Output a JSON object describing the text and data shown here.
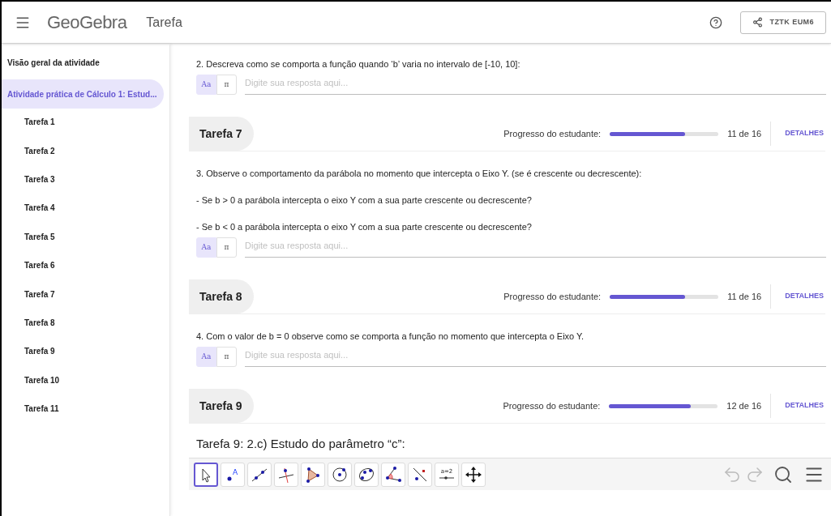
{
  "header": {
    "logo": "GeoGebra",
    "title": "Tarefa",
    "share_code": "TZTK EUM6"
  },
  "sidebar": {
    "overview": "Visão geral da atividade",
    "activity": {
      "label": "Atividade prática de Cálculo 1: Estud...",
      "selected": true
    },
    "items": [
      {
        "label": "Tarefa 1",
        "selected": false
      },
      {
        "label": "Tarefa 2",
        "selected": false
      },
      {
        "label": "Tarefa 3",
        "selected": false
      },
      {
        "label": "Tarefa 4",
        "selected": false
      },
      {
        "label": "Tarefa 5",
        "selected": false
      },
      {
        "label": "Tarefa 6",
        "selected": false
      },
      {
        "label": "Tarefa 7",
        "selected": false
      },
      {
        "label": "Tarefa 8",
        "selected": false
      },
      {
        "label": "Tarefa 9",
        "selected": false
      },
      {
        "label": "Tarefa 10",
        "selected": false
      },
      {
        "label": "Tarefa 11",
        "selected": false
      }
    ]
  },
  "blocks": [
    {
      "kind": "question",
      "lines": [
        "2. Descreva como se comporta a função quando ‘b’ varia no intervalo de [-10, 10]:"
      ],
      "modes": [
        {
          "label": "Aa",
          "selected": true
        },
        {
          "label": "π",
          "selected": false
        }
      ],
      "placeholder": "Digite sua resposta aqui..."
    },
    {
      "kind": "task",
      "title": "Tarefa 7",
      "progress_label": "Progresso do estudante:",
      "level": 0.69,
      "count": "11 de 16",
      "details": "DETALHES"
    },
    {
      "kind": "question",
      "lines": [
        "3. Observe o comportamento da parábola no momento que intercepta o Eixo Y. (se é crescente ou decrescente):",
        "- Se b > 0 a parábola intercepta o eixo Y com a sua parte crescente ou decrescente?",
        "- Se b < 0 a parábola intercepta o eixo Y com a sua parte crescente ou decrescente?"
      ],
      "modes": [
        {
          "label": "Aa",
          "selected": true
        },
        {
          "label": "π",
          "selected": false
        }
      ],
      "placeholder": "Digite sua resposta aqui..."
    },
    {
      "kind": "task",
      "title": "Tarefa 8",
      "progress_label": "Progresso do estudante:",
      "level": 0.69,
      "count": "11 de 16",
      "details": "DETALHES"
    },
    {
      "kind": "question",
      "lines": [
        "4. Com o valor de b = 0 observe como se comporta a função no momento que intercepta o Eixo Y."
      ],
      "modes": [
        {
          "label": "Aa",
          "selected": true
        },
        {
          "label": "π",
          "selected": false
        }
      ],
      "placeholder": "Digite sua resposta aqui..."
    },
    {
      "kind": "task",
      "title": "Tarefa 9",
      "progress_label": "Progresso do estudante:",
      "level": 0.75,
      "count": "12 de 16",
      "details": "DETALHES"
    },
    {
      "kind": "applet",
      "title": "Tarefa 9: 2.c) Estudo do parâmetro “c”:",
      "tools": [
        {
          "kind": "move",
          "selected": true
        },
        {
          "kind": "point",
          "selected": false,
          "label": "A"
        },
        {
          "kind": "line",
          "selected": false
        },
        {
          "kind": "perpendicular",
          "selected": false
        },
        {
          "kind": "polygon",
          "selected": false
        },
        {
          "kind": "circle",
          "selected": false
        },
        {
          "kind": "conic",
          "selected": false
        },
        {
          "kind": "angle",
          "selected": false
        },
        {
          "kind": "reflect",
          "selected": false
        },
        {
          "kind": "slider",
          "selected": false,
          "label": "a=2"
        },
        {
          "kind": "move_view",
          "selected": false
        }
      ]
    }
  ]
}
